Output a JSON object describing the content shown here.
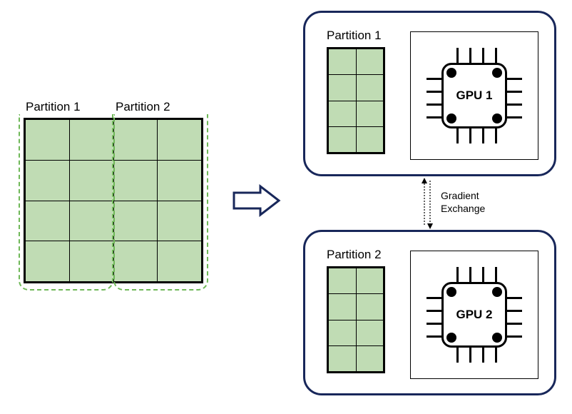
{
  "diagram": {
    "leftLabels": {
      "p1": "Partition 1",
      "p2": "Partition 2"
    },
    "arrowColor": "#18275a",
    "gradientExchange": {
      "line1": "Gradient",
      "line2": "Exchange"
    },
    "node1": {
      "partitionLabel": "Partition 1",
      "gpuLabel": "GPU 1"
    },
    "node2": {
      "partitionLabel": "Partition 2",
      "gpuLabel": "GPU 2"
    },
    "cellColor": "#c0dcb4",
    "dashColor": "#6fb858",
    "cardBorderColor": "#18275a"
  },
  "chart_data": {
    "type": "table",
    "description": "Conceptual diagram of data/model partitioning across two GPUs with gradient exchange between them.",
    "left_matrix": {
      "rows": 4,
      "cols": 4,
      "partition1_cols": [
        0,
        1
      ],
      "partition2_cols": [
        2,
        3
      ]
    },
    "nodes": [
      {
        "name": "GPU 1",
        "partition": "Partition 1",
        "mini_matrix": {
          "rows": 4,
          "cols": 2
        }
      },
      {
        "name": "GPU 2",
        "partition": "Partition 2",
        "mini_matrix": {
          "rows": 4,
          "cols": 2
        }
      }
    ],
    "edge": {
      "from": "GPU 1",
      "to": "GPU 2",
      "label": "Gradient Exchange",
      "bidirectional": true
    }
  }
}
